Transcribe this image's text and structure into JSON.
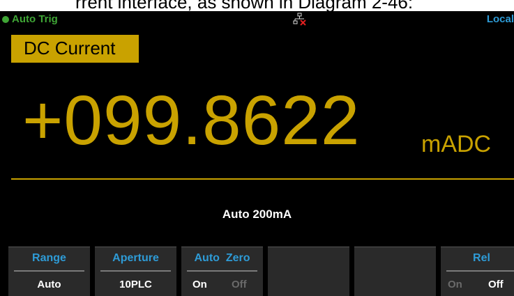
{
  "document_text": "rrent interface, as shown in Diagram 2-46:",
  "status": {
    "trigger": "Auto Trig",
    "mode": "Local",
    "lan_icon": "lan-disconnected-icon"
  },
  "function": {
    "label": "DC Current"
  },
  "measurement": {
    "value": "+099.8622",
    "unit": "mADC"
  },
  "range_info": "Auto  200mA",
  "softkeys": [
    {
      "label": "Range",
      "value": "Auto"
    },
    {
      "label": "Aperture",
      "value": "10PLC"
    },
    {
      "label": "Auto  Zero",
      "on": "On",
      "off": "Off",
      "selected": "On"
    },
    {
      "label": ""
    },
    {
      "label": ""
    },
    {
      "label": "Rel",
      "on": "On",
      "off": "Off",
      "selected": "Off"
    }
  ],
  "colors": {
    "accent": "#c9a200",
    "status_green": "#3fa535",
    "label_blue": "#2e9bd6"
  }
}
